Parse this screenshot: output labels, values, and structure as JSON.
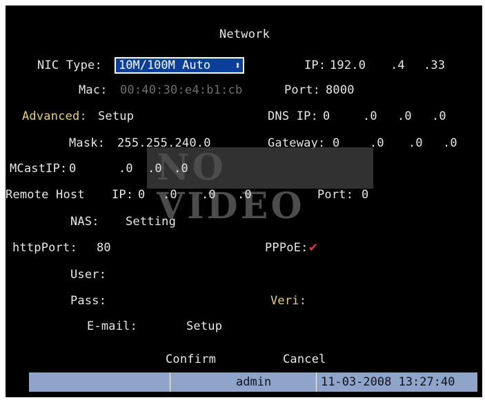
{
  "title": "Network",
  "nic": {
    "label": "NIC Type:",
    "value": "10M/100M Auto",
    "arrow": "⬍"
  },
  "ip": {
    "label": "IP:",
    "octets": [
      "192.0",
      ".4",
      ".33"
    ]
  },
  "mac": {
    "label": "Mac:",
    "value": "00:40:30:e4:b1:cb"
  },
  "port": {
    "label": "Port:",
    "value": "8000"
  },
  "advanced": {
    "label": "Advanced:",
    "button": "Setup"
  },
  "dns": {
    "label": "DNS IP:",
    "octets": [
      "0",
      ".0",
      ".0",
      ".0"
    ]
  },
  "mask": {
    "label": "Mask:",
    "value": "255.255.240.0"
  },
  "gateway": {
    "label": "Gateway:",
    "octets": [
      "0",
      ".0",
      ".0",
      ".0"
    ]
  },
  "mcast": {
    "label": "MCastIP:",
    "octets": [
      "0",
      ".0",
      ".0",
      ".0"
    ]
  },
  "remote_host": {
    "label": "Remote Host",
    "ip_label": "IP:",
    "octets": [
      "0",
      ".0",
      ".0",
      ".0"
    ],
    "port_label": "Port:",
    "port_value": "0"
  },
  "nas": {
    "label": "NAS:",
    "button": "Setting"
  },
  "http_port": {
    "label": "httpPort:",
    "value": "80"
  },
  "pppoe": {
    "label": "PPPoE:",
    "checked": true,
    "check_glyph": "✔"
  },
  "user": {
    "label": "User:"
  },
  "pass": {
    "label": "Pass:"
  },
  "veri": {
    "label": "Veri:"
  },
  "email": {
    "label": "E-mail:",
    "button": "Setup"
  },
  "actions": {
    "confirm": "Confirm",
    "cancel": "Cancel"
  },
  "watermark": "NO VIDEO",
  "status": {
    "user": "admin",
    "datetime": "11-03-2008 13:27:40"
  },
  "colors": {
    "highlight": "#0b3f9a",
    "label_yellow": "#e6d27a",
    "check": "#d23a3a",
    "status_bar": "#8ea4c8"
  }
}
